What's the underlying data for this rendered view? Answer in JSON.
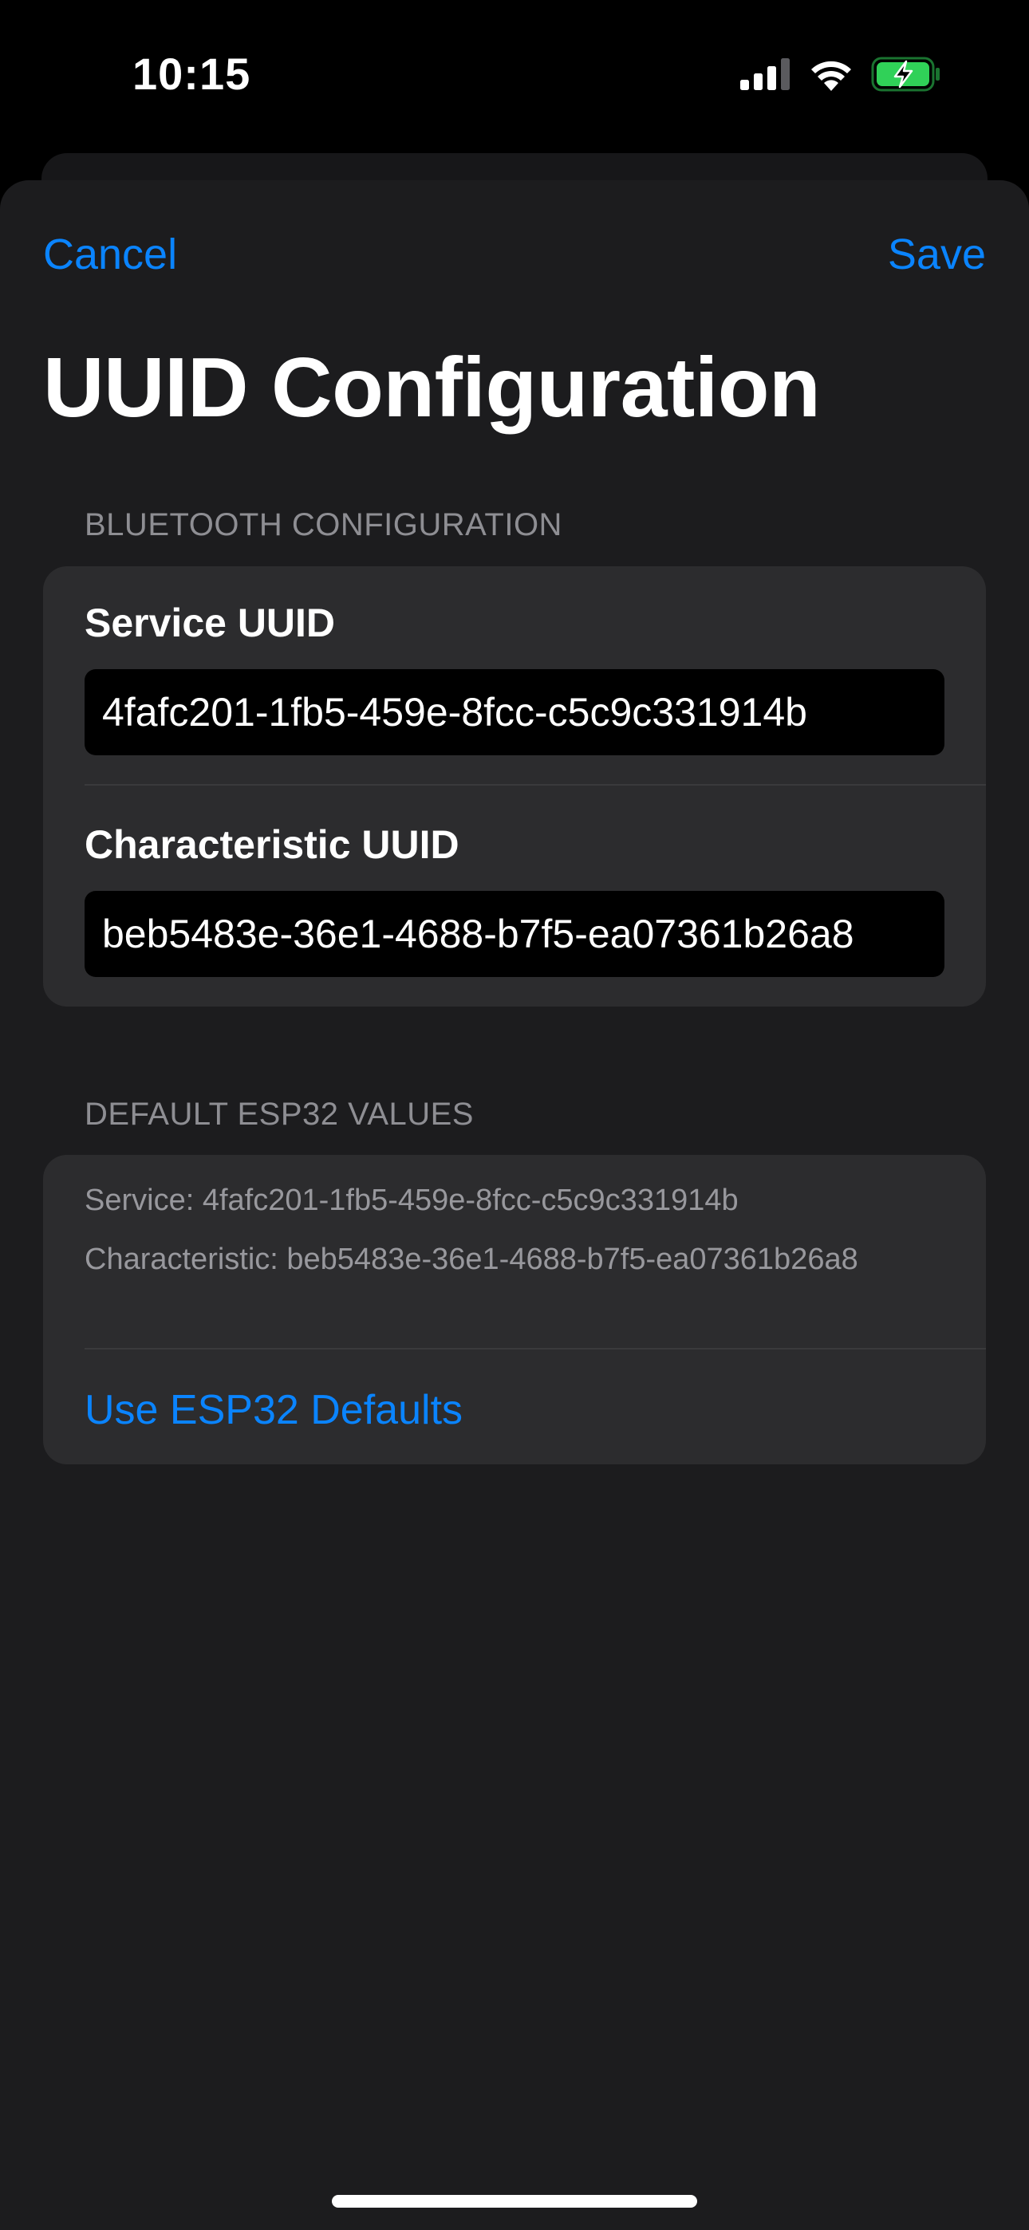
{
  "status_bar": {
    "time": "10:15",
    "icons": [
      "cellular-signal-icon",
      "wifi-icon",
      "battery-charging-icon"
    ]
  },
  "nav": {
    "cancel_label": "Cancel",
    "save_label": "Save"
  },
  "title": "UUID Configuration",
  "bluetooth_section": {
    "header": "BLUETOOTH CONFIGURATION",
    "service_label": "Service UUID",
    "service_value": "4fafc201-1fb5-459e-8fcc-c5c9c331914b",
    "characteristic_label": "Characteristic UUID",
    "characteristic_value": "beb5483e-36e1-4688-b7f5-ea07361b26a8"
  },
  "defaults_section": {
    "header": "DEFAULT ESP32 VALUES",
    "service_text": "Service: 4fafc201-1fb5-459e-8fcc-c5c9c331914b",
    "characteristic_text": "Characteristic: beb5483e-36e1-4688-b7f5-ea07361b26a8",
    "button_label": "Use ESP32 Defaults"
  },
  "colors": {
    "accent": "#0a84ff",
    "battery": "#30d158",
    "sheet_background": "#1c1c1e",
    "group_background": "#2c2c2e"
  }
}
